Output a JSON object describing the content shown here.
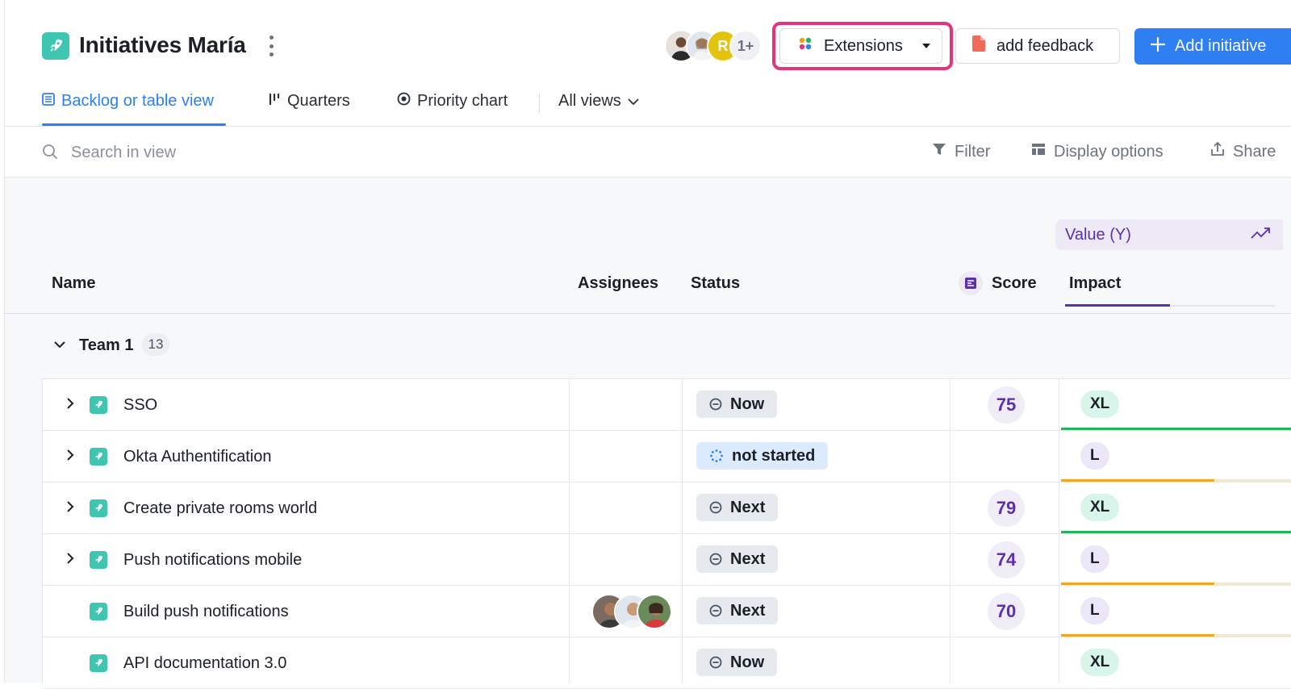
{
  "header": {
    "title": "Initiatives María",
    "avatars_more": "1+",
    "avatar_initial": "R",
    "extensions_label": "Extensions",
    "feedback_label": "add feedback",
    "add_label": "Add initiative"
  },
  "tabs": [
    {
      "label": "Backlog or table view"
    },
    {
      "label": "Quarters"
    },
    {
      "label": "Priority chart"
    },
    {
      "label": "All views"
    }
  ],
  "toolbar": {
    "search_placeholder": "Search in view",
    "filter": "Filter",
    "display": "Display options",
    "share": "Share"
  },
  "table": {
    "value_chip": "Value (Y)",
    "headers": {
      "name": "Name",
      "assignees": "Assignees",
      "status": "Status",
      "score": "Score",
      "impact": "Impact"
    },
    "group": {
      "label": "Team 1",
      "count": "13"
    },
    "rows": [
      {
        "name": "SSO",
        "status": "Now",
        "score": "75",
        "impact": "XL"
      },
      {
        "name": "Okta Authentification",
        "status": "not started",
        "score": "",
        "impact": "L"
      },
      {
        "name": "Create private rooms world",
        "status": "Next",
        "score": "79",
        "impact": "XL"
      },
      {
        "name": "Push notifications mobile",
        "status": "Next",
        "score": "74",
        "impact": "L"
      },
      {
        "name": "Build push notifications",
        "status": "Next",
        "score": "70",
        "impact": "L"
      },
      {
        "name": "API documentation 3.0",
        "status": "Now",
        "score": "",
        "impact": "XL"
      }
    ]
  },
  "colors": {
    "accent": "#2e7ff2",
    "highlight": "#e5357a",
    "purple": "#5b2fb0",
    "green": "#22b35e",
    "orange": "#f5a524"
  }
}
